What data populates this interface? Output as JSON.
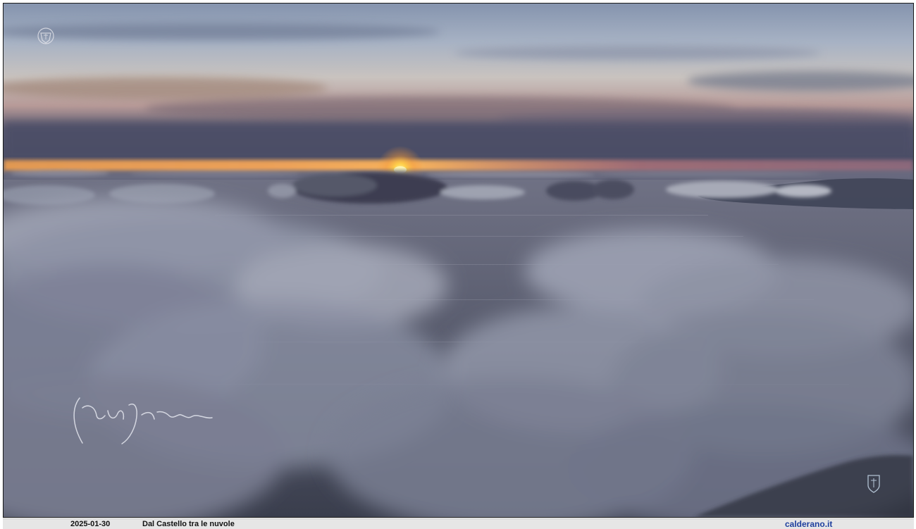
{
  "caption": {
    "date": "2025-01-30",
    "title": "Dal Castello tra le nuvole",
    "site": "calderano.it"
  },
  "photo": {
    "subject": "sunset above clouds over the sea",
    "watermark_logo_icon": "crest-icon",
    "signature": "handwritten-signature",
    "corner_logo_icon": "shield-crest-icon"
  },
  "colors": {
    "sun": "#ffd24a",
    "horizon_glow": "#f39a4a",
    "link": "#1d3f9e",
    "caption_bar": "#e6e6e6"
  }
}
